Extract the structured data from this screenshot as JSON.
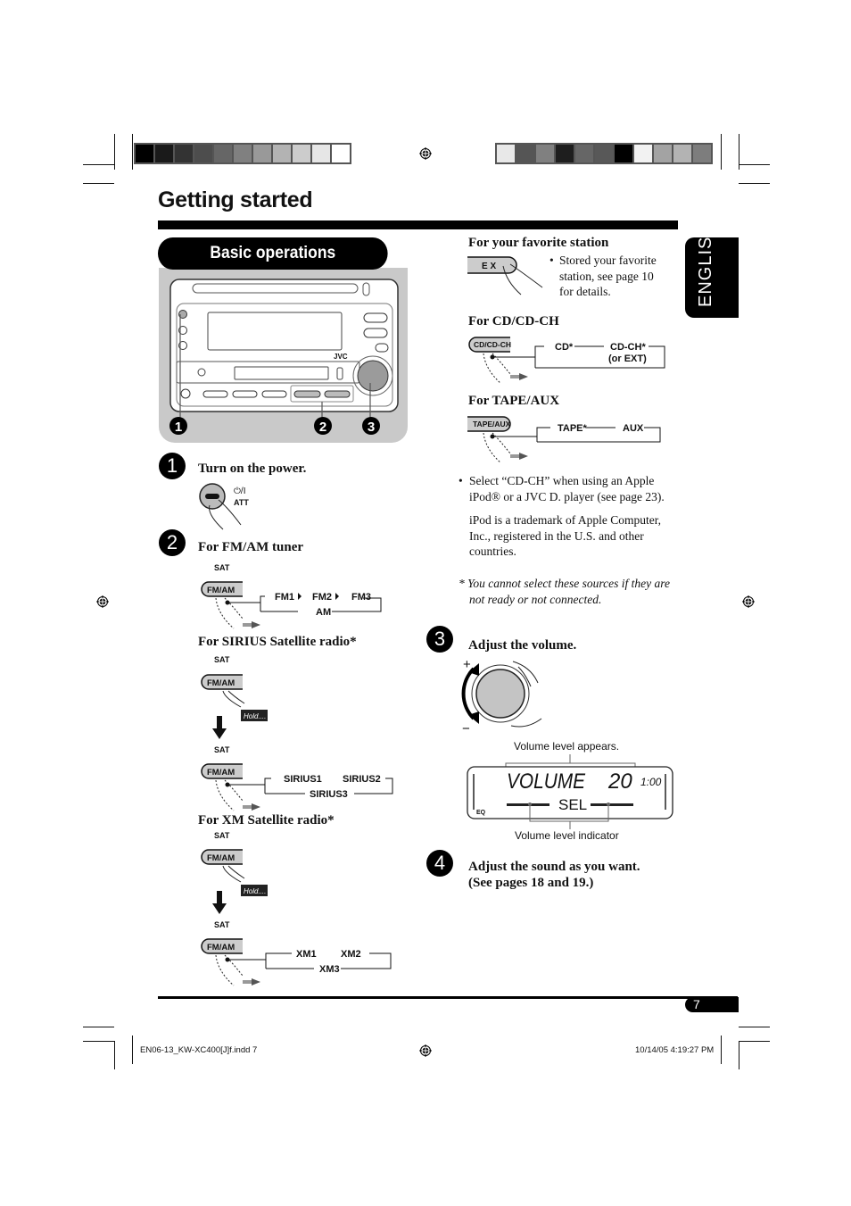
{
  "header": {
    "swatches_left": [
      "#000000",
      "#1a1a1a",
      "#333333",
      "#4d4d4d",
      "#666666",
      "#808080",
      "#999999",
      "#b3b3b3",
      "#cccccc",
      "#e6e6e6",
      "#ffffff"
    ],
    "swatches_right": [
      "#e8e8e8",
      "#555555",
      "#808080",
      "#1e1e1e",
      "#666666",
      "#585858",
      "#000000",
      "#f2f2f2",
      "#a3a3a3",
      "#b3b3b3",
      "#7d7d7d"
    ]
  },
  "page": {
    "title": "Getting started",
    "section_title": "Basic operations",
    "language_tab": "ENGLISH",
    "page_number": "7"
  },
  "device_callouts": [
    "1",
    "2",
    "3"
  ],
  "device_brand": "JVC",
  "steps": [
    {
      "number": "1",
      "heading": "Turn on the power.",
      "button_labels": [
        "⏻/I",
        "ATT"
      ]
    },
    {
      "number": "2",
      "fm_am": {
        "heading": "For FM/AM tuner",
        "sat_label": "SAT",
        "button": "FM/AM",
        "cycle": [
          "FM1",
          "FM2",
          "FM3",
          "AM"
        ]
      },
      "sirius": {
        "heading": "For SIRIUS Satellite radio*",
        "sat_label": "SAT",
        "button": "FM/AM",
        "hold": "Hold....",
        "cycle": [
          "SIRIUS1",
          "SIRIUS2",
          "SIRIUS3"
        ]
      },
      "xm": {
        "heading": "For XM Satellite radio*",
        "sat_label": "SAT",
        "button": "FM/AM",
        "hold": "Hold....",
        "cycle": [
          "XM1",
          "XM2",
          "XM3"
        ]
      },
      "favorite": {
        "heading": "For your favorite station",
        "button": "E X",
        "note": "Stored your favorite station, see page 10 for details."
      },
      "cd": {
        "heading": "For CD/CD-CH",
        "button": "CD/CD-CH",
        "cycle": [
          "CD*",
          "CD-CH*",
          "(or EXT)"
        ]
      },
      "tape": {
        "heading": "For TAPE/AUX",
        "button": "TAPE/AUX",
        "cycle": [
          "TAPE*",
          "AUX"
        ]
      },
      "note_bullet": "Select “CD-CH” when using an Apple iPod® or a JVC D. player (see page 23).",
      "trademark": "iPod is a trademark of Apple Computer, Inc., registered in the U.S. and other countries.",
      "footnote": "* You cannot select these sources if they are not ready or not connected."
    },
    {
      "number": "3",
      "heading": "Adjust the volume.",
      "plus": "+",
      "minus": "−",
      "caption_top": "Volume level appears.",
      "display_main": "VOLUME",
      "display_value": "20",
      "display_clock": "1:00",
      "display_sub": "SEL",
      "display_eq": "EQ",
      "caption_bottom": "Volume level indicator"
    },
    {
      "number": "4",
      "heading_line1": "Adjust the sound as you want.",
      "heading_line2": "(See pages 18 and 19.)"
    }
  ],
  "footer": {
    "file": "EN06-13_KW-XC400[J]f.indd   7",
    "timestamp": "10/14/05   4:19:27 PM"
  }
}
